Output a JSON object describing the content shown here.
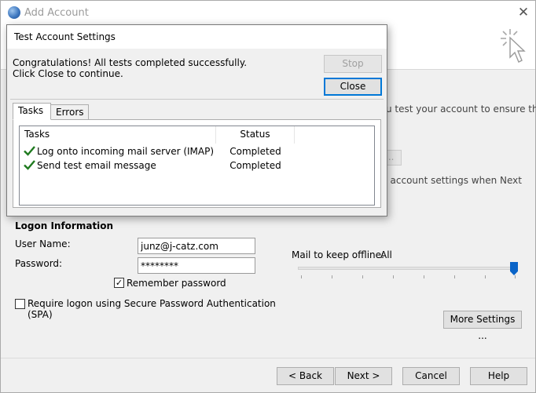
{
  "main_window": {
    "title": "Add Account",
    "bg_text_1": "u test your account to ensure that",
    "bg_button_partial": "...",
    "bg_text_2": "t account settings when Next",
    "logon": {
      "section_title": "Logon Information",
      "user_name_label": "User Name:",
      "user_name_value": "junz@j-catz.com",
      "password_label": "Password:",
      "password_value": "********",
      "remember_password_label": "Remember password",
      "remember_password_checked": true,
      "spa_label_line1": "Require logon using Secure Password Authentication",
      "spa_label_line2": "(SPA)",
      "spa_checked": false
    },
    "offline": {
      "label": "Mail to keep offline:",
      "value": "All",
      "slider_level": 1.0
    },
    "more_settings_label": "More Settings ...",
    "footer_buttons": {
      "back": "< Back",
      "next": "Next >",
      "cancel": "Cancel",
      "help": "Help"
    }
  },
  "dialog": {
    "title": "Test Account Settings",
    "message": "Congratulations! All tests completed successfully. Click Close to continue.",
    "stop_label": "Stop",
    "close_label": "Close",
    "tabs": [
      "Tasks",
      "Errors"
    ],
    "active_tab": "Tasks",
    "columns": [
      "Tasks",
      "Status"
    ],
    "tasks": [
      {
        "name": "Log onto incoming mail server (IMAP)",
        "status": "Completed",
        "icon": "check-icon"
      },
      {
        "name": "Send test email message",
        "status": "Completed",
        "icon": "check-icon"
      }
    ]
  },
  "colors": {
    "accent": "#0078d7",
    "check_green": "#1f7a1f",
    "slider_thumb": "#0a64c8"
  }
}
